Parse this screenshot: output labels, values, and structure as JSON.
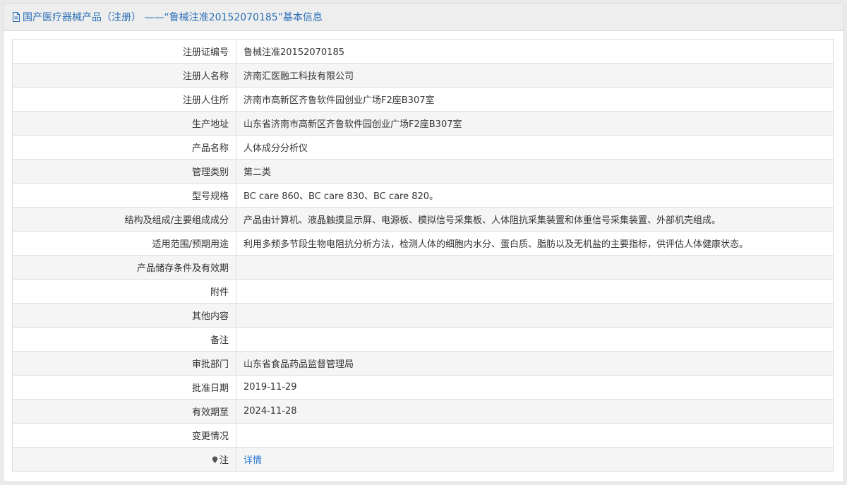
{
  "header": {
    "title": "国产医疗器械产品（注册） ——“鲁械注准20152070185”基本信息"
  },
  "rows": [
    {
      "label": "注册证编号",
      "value": "鲁械注准20152070185"
    },
    {
      "label": "注册人名称",
      "value": "济南汇医融工科技有限公司"
    },
    {
      "label": "注册人住所",
      "value": "济南市高新区齐鲁软件园创业广场F2座B307室"
    },
    {
      "label": "生产地址",
      "value": "山东省济南市高新区齐鲁软件园创业广场F2座B307室"
    },
    {
      "label": "产品名称",
      "value": "人体成分分析仪"
    },
    {
      "label": "管理类别",
      "value": "第二类"
    },
    {
      "label": "型号规格",
      "value": "BC care 860、BC care 830、BC care 820。"
    },
    {
      "label": "结构及组成/主要组成成分",
      "value": "产品由计算机、液晶触摸显示屏、电源板、模拟信号采集板、人体阻抗采集装置和体重信号采集装置、外部机壳组成。"
    },
    {
      "label": "适用范围/预期用途",
      "value": "利用多频多节段生物电阻抗分析方法，检测人体的细胞内水分、蛋白质、脂肪以及无机盐的主要指标，供评估人体健康状态。"
    },
    {
      "label": "产品储存条件及有效期",
      "value": ""
    },
    {
      "label": "附件",
      "value": ""
    },
    {
      "label": "其他内容",
      "value": ""
    },
    {
      "label": "备注",
      "value": ""
    },
    {
      "label": "审批部门",
      "value": "山东省食品药品监督管理局"
    },
    {
      "label": "批准日期",
      "value": "2019-11-29"
    },
    {
      "label": "有效期至",
      "value": "2024-11-28"
    },
    {
      "label": "变更情况",
      "value": ""
    }
  ],
  "note": {
    "label": "注",
    "link_text": "详情",
    "icon": "pin-icon"
  }
}
